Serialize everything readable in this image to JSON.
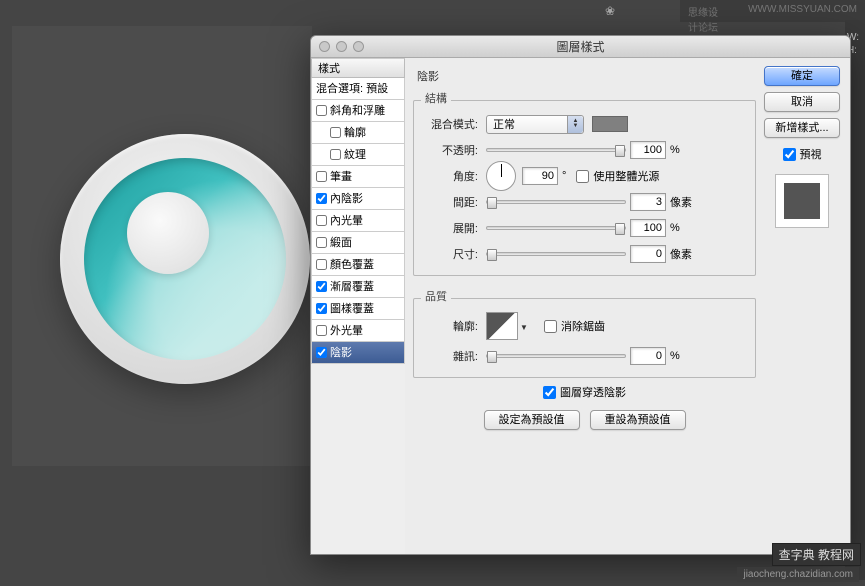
{
  "watermarks": {
    "top_left": "思缘设计论坛",
    "top_right": "WWW.MISSYUAN.COM",
    "bottom_site": "jiaocheng.chazidian.com",
    "bottom_brand": "查字典 教程网"
  },
  "right_axis": {
    "label1": "W:",
    "label2": "H:"
  },
  "dialog": {
    "title": "圖層樣式",
    "sidebar_header": "樣式",
    "sidebar": [
      {
        "label": "混合選項: 預設",
        "checkbox": false,
        "checked": false,
        "selected": false
      },
      {
        "label": "斜角和浮雕",
        "checkbox": true,
        "checked": false,
        "selected": false
      },
      {
        "label": "輪廓",
        "checkbox": true,
        "checked": false,
        "selected": false,
        "indent": true
      },
      {
        "label": "紋理",
        "checkbox": true,
        "checked": false,
        "selected": false,
        "indent": true
      },
      {
        "label": "筆畫",
        "checkbox": true,
        "checked": false,
        "selected": false
      },
      {
        "label": "內陰影",
        "checkbox": true,
        "checked": true,
        "selected": false
      },
      {
        "label": "內光暈",
        "checkbox": true,
        "checked": false,
        "selected": false
      },
      {
        "label": "緞面",
        "checkbox": true,
        "checked": false,
        "selected": false
      },
      {
        "label": "顏色覆蓋",
        "checkbox": true,
        "checked": false,
        "selected": false
      },
      {
        "label": "漸層覆蓋",
        "checkbox": true,
        "checked": true,
        "selected": false
      },
      {
        "label": "圖樣覆蓋",
        "checkbox": true,
        "checked": true,
        "selected": false
      },
      {
        "label": "外光暈",
        "checkbox": true,
        "checked": false,
        "selected": false
      },
      {
        "label": "陰影",
        "checkbox": true,
        "checked": true,
        "selected": true
      }
    ],
    "panel_title": "陰影",
    "structure": {
      "title": "結構",
      "blend_mode_label": "混合模式:",
      "blend_mode_value": "正常",
      "opacity_label": "不透明:",
      "opacity_value": "100",
      "opacity_unit": "%",
      "angle_label": "角度:",
      "angle_value": "90",
      "angle_unit": "°",
      "global_light_label": "使用整體光源",
      "distance_label": "間距:",
      "distance_value": "3",
      "distance_unit": "像素",
      "spread_label": "展開:",
      "spread_value": "100",
      "spread_unit": "%",
      "size_label": "尺寸:",
      "size_value": "0",
      "size_unit": "像素"
    },
    "quality": {
      "title": "品質",
      "contour_label": "輪廓:",
      "antialias_label": "消除鋸齒",
      "noise_label": "雜訊:",
      "noise_value": "0",
      "noise_unit": "%"
    },
    "knockout_label": "圖層穿透陰影",
    "buttons": {
      "ok": "確定",
      "cancel": "取消",
      "new_style": "新增樣式...",
      "preview": "預視",
      "make_default": "設定為預設值",
      "reset_default": "重設為預設值"
    }
  }
}
